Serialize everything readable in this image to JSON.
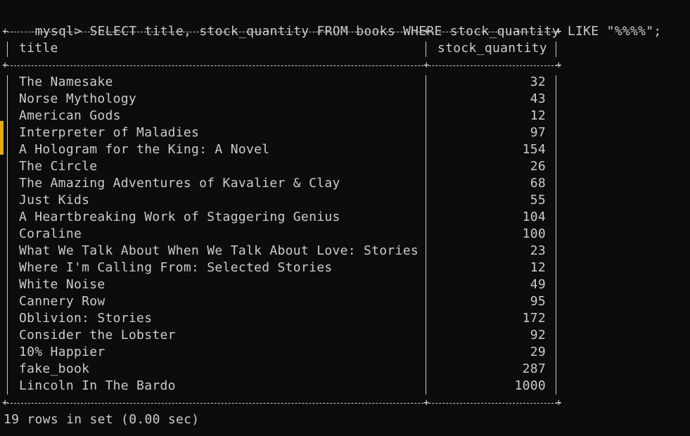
{
  "terminal": {
    "prompt": "mysql>",
    "query": "SELECT title, stock_quantity FROM books WHERE stock_quantity LIKE \"%%%%\";",
    "columns": [
      "title",
      "stock_quantity"
    ],
    "rows": [
      {
        "title": "The Namesake",
        "stock_quantity": "32"
      },
      {
        "title": "Norse Mythology",
        "stock_quantity": "43"
      },
      {
        "title": "American Gods",
        "stock_quantity": "12"
      },
      {
        "title": "Interpreter of Maladies",
        "stock_quantity": "97"
      },
      {
        "title": "A Hologram for the King: A Novel",
        "stock_quantity": "154"
      },
      {
        "title": "The Circle",
        "stock_quantity": "26"
      },
      {
        "title": "The Amazing Adventures of Kavalier & Clay",
        "stock_quantity": "68"
      },
      {
        "title": "Just Kids",
        "stock_quantity": "55"
      },
      {
        "title": "A Heartbreaking Work of Staggering Genius",
        "stock_quantity": "104"
      },
      {
        "title": "Coraline",
        "stock_quantity": "100"
      },
      {
        "title": "What We Talk About When We Talk About Love: Stories",
        "stock_quantity": "23"
      },
      {
        "title": "Where I'm Calling From: Selected Stories",
        "stock_quantity": "12"
      },
      {
        "title": "White Noise",
        "stock_quantity": "49"
      },
      {
        "title": "Cannery Row",
        "stock_quantity": "95"
      },
      {
        "title": "Oblivion: Stories",
        "stock_quantity": "172"
      },
      {
        "title": "Consider the Lobster",
        "stock_quantity": "92"
      },
      {
        "title": "10% Happier",
        "stock_quantity": "29"
      },
      {
        "title": "fake_book",
        "stock_quantity": "287"
      },
      {
        "title": "Lincoln In The Bardo",
        "stock_quantity": "1000"
      }
    ],
    "summary": "19 rows in set (0.00 sec)"
  },
  "colors": {
    "background": "#0c0c0c",
    "text": "#cccccc",
    "left_edge_accent": "#e6a817"
  }
}
